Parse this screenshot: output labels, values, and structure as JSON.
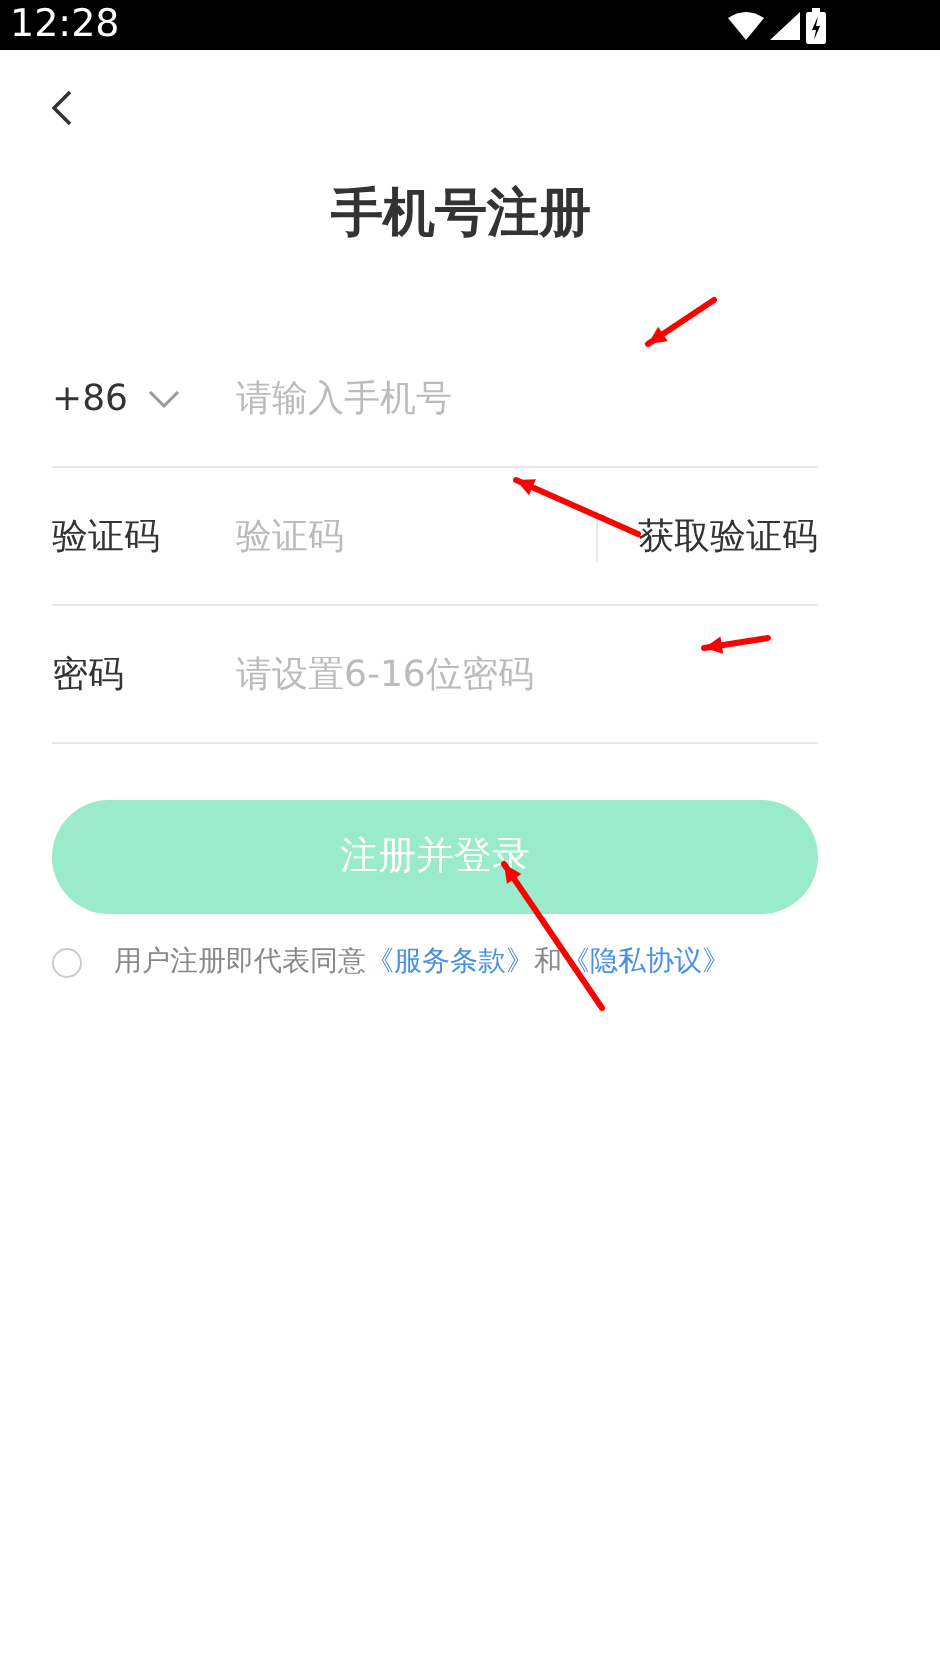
{
  "status_bar": {
    "time": "12:28"
  },
  "title": "手机号注册",
  "phone": {
    "country_code": "+86",
    "placeholder": "请输入手机号"
  },
  "code": {
    "label": "验证码",
    "placeholder": "验证码",
    "button": "获取验证码"
  },
  "password": {
    "label": "密码",
    "placeholder": "请设置6-16位密码"
  },
  "submit": {
    "label": "注册并登录",
    "disabled": true
  },
  "agreement": {
    "checked": false,
    "text": "用户注册即代表同意",
    "link_1": "《服务条款》",
    "joiner": "和",
    "link_2": "《隐私协议》"
  }
}
